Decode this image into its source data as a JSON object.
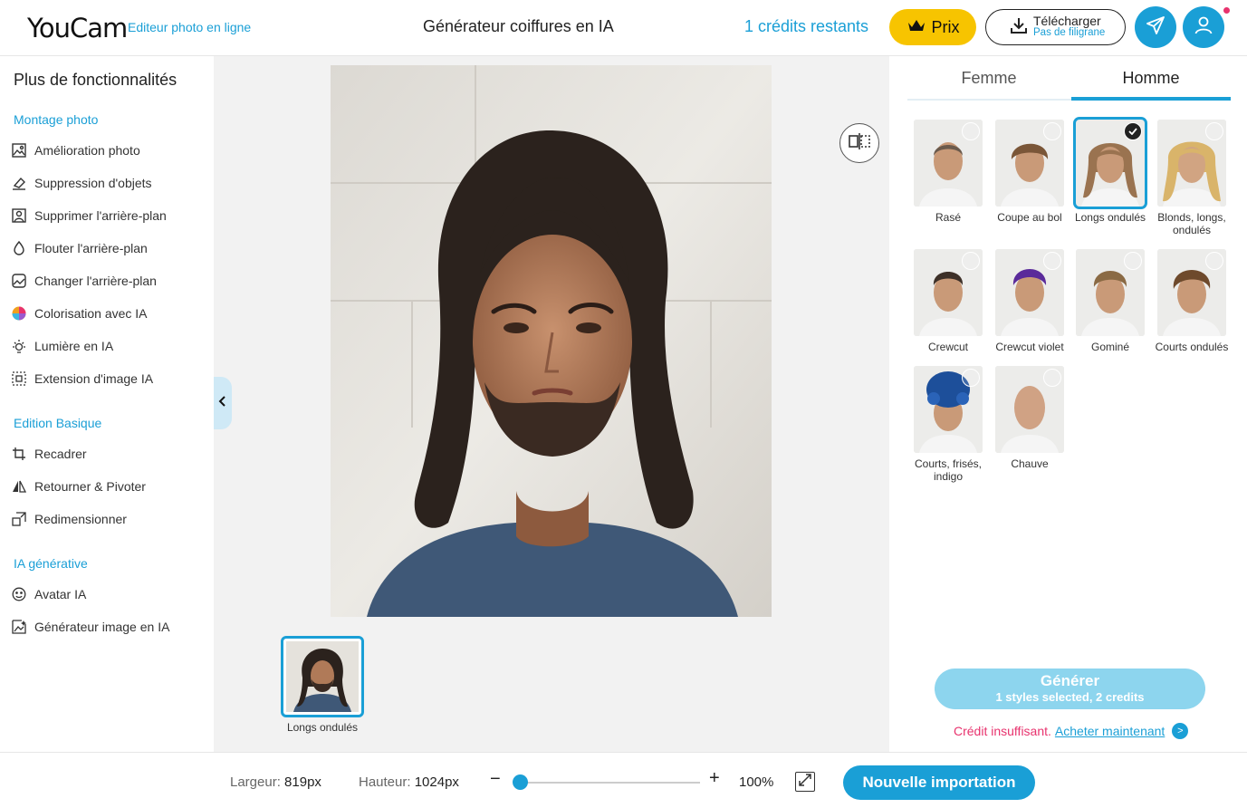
{
  "header": {
    "logo": "YouCam",
    "logo_sub": "Editeur photo en ligne",
    "title": "Générateur coiffures en IA",
    "credits": "1 crédits restants",
    "prix_label": "Prix",
    "download_label": "Télécharger",
    "download_sub": "Pas de filigrane"
  },
  "sidebar": {
    "title": "Plus de fonctionnalités",
    "sections": [
      {
        "label": "Montage photo",
        "items": [
          "Amélioration photo",
          "Suppression d'objets",
          "Supprimer l'arrière-plan",
          "Flouter l'arrière-plan",
          "Changer l'arrière-plan",
          "Colorisation avec IA",
          "Lumière en IA",
          "Extension d'image IA"
        ]
      },
      {
        "label": "Edition Basique",
        "items": [
          "Recadrer",
          "Retourner & Pivoter",
          "Redimensionner"
        ]
      },
      {
        "label": "IA générative",
        "items": [
          "Avatar IA",
          "Générateur image en IA"
        ]
      }
    ]
  },
  "canvas": {
    "thumb_label": "Longs ondulés"
  },
  "panel": {
    "tabs": [
      "Femme",
      "Homme"
    ],
    "active_tab": "Homme",
    "styles": [
      {
        "label": "Rasé",
        "selected": false
      },
      {
        "label": "Coupe au bol",
        "selected": false
      },
      {
        "label": "Longs ondulés",
        "selected": true
      },
      {
        "label": "Blonds, longs, ondulés",
        "selected": false
      },
      {
        "label": "Crewcut",
        "selected": false
      },
      {
        "label": "Crewcut violet",
        "selected": false
      },
      {
        "label": "Gominé",
        "selected": false
      },
      {
        "label": "Courts ondulés",
        "selected": false
      },
      {
        "label": "Courts, frisés, indigo",
        "selected": false
      },
      {
        "label": "Chauve",
        "selected": false
      }
    ],
    "generate_label": "Générer",
    "generate_sub": "1 styles selected, 2 credits",
    "insufficient": "Crédit insuffisant.",
    "buy_link": "Acheter maintenant"
  },
  "bottom": {
    "width_label": "Largeur:",
    "width_value": "819px",
    "height_label": "Hauteur:",
    "height_value": "1024px",
    "zoom": "100%",
    "import_label": "Nouvelle importation"
  },
  "colors": {
    "accent": "#1a9fd6",
    "prix": "#f7c400",
    "warning": "#e8336e"
  }
}
